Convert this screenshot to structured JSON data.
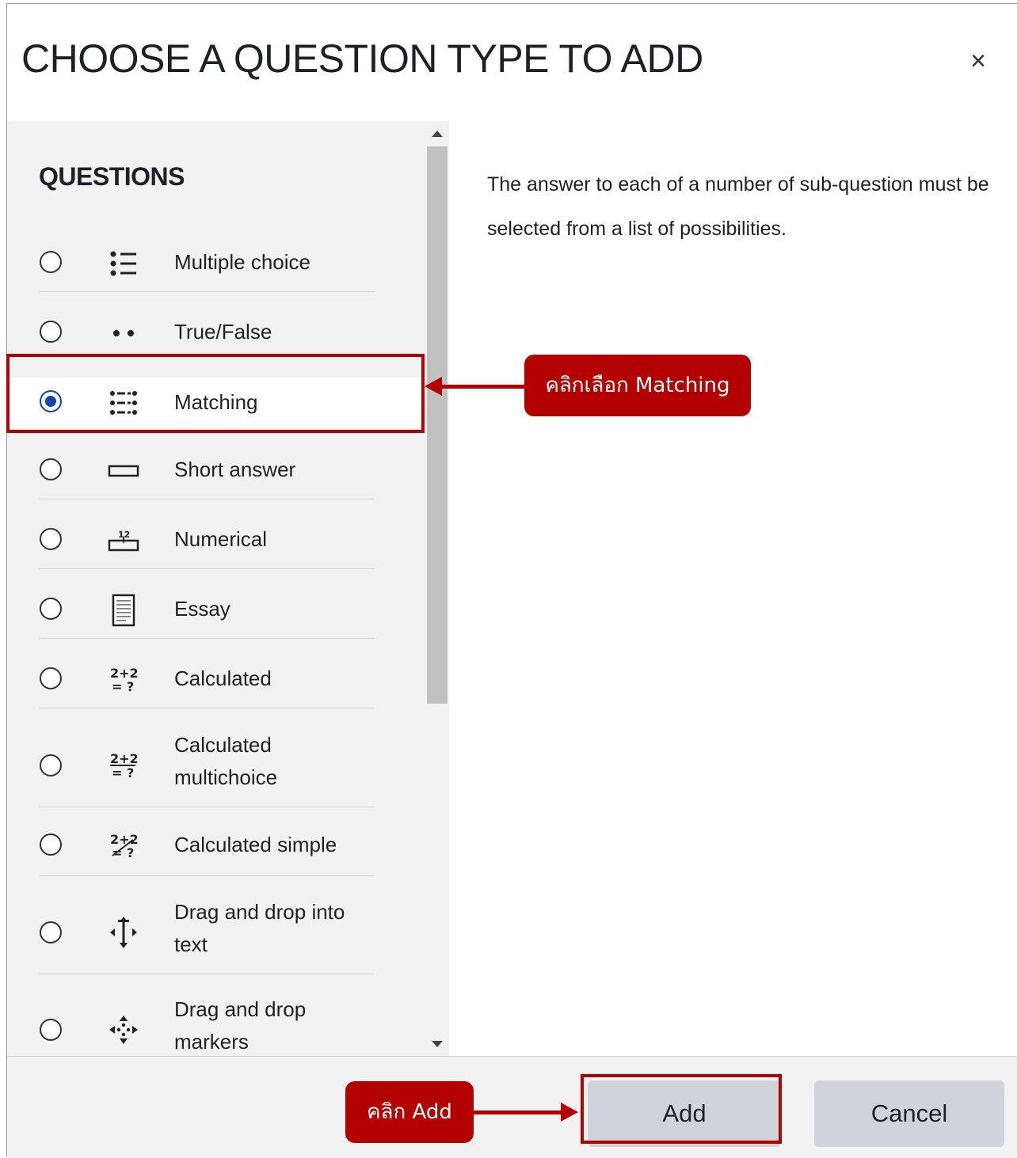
{
  "dialog": {
    "title": "CHOOSE A QUESTION TYPE TO ADD",
    "close_glyph": "×"
  },
  "questions": {
    "section_title": "QUESTIONS",
    "items": [
      {
        "label": "Multiple choice",
        "icon": "multiple-choice-icon",
        "selected": false
      },
      {
        "label": "True/False",
        "icon": "true-false-icon",
        "selected": false
      },
      {
        "label": "Matching",
        "icon": "matching-icon",
        "selected": true
      },
      {
        "label": "Short answer",
        "icon": "short-answer-icon",
        "selected": false
      },
      {
        "label": "Numerical",
        "icon": "numerical-icon",
        "selected": false
      },
      {
        "label": "Essay",
        "icon": "essay-icon",
        "selected": false
      },
      {
        "label": "Calculated",
        "icon": "calculated-icon",
        "selected": false
      },
      {
        "label": "Calculated multichoice",
        "line1": "Calculated",
        "line2": "multichoice",
        "icon": "calculated-multichoice-icon",
        "selected": false
      },
      {
        "label": "Calculated simple",
        "icon": "calculated-simple-icon",
        "selected": false
      },
      {
        "label": "Drag and drop into text",
        "line1": "Drag and drop into",
        "line2": "text",
        "icon": "drag-drop-text-icon",
        "selected": false
      },
      {
        "label": "Drag and drop markers",
        "line1": "Drag and drop",
        "line2": "markers",
        "icon": "drag-drop-markers-icon",
        "selected": false
      }
    ]
  },
  "description": "The answer to each of a number of sub-question must be selected from a list of possibilities.",
  "footer": {
    "add_label": "Add",
    "cancel_label": "Cancel"
  },
  "annotations": {
    "matching_callout": "คลิกเลือก Matching",
    "add_callout": "คลิก Add",
    "highlight_color": "#b30000"
  },
  "colors": {
    "radio_selected": "#0f47ad",
    "button_bg": "#ced4da",
    "panel_bg": "#f2f2f2"
  }
}
